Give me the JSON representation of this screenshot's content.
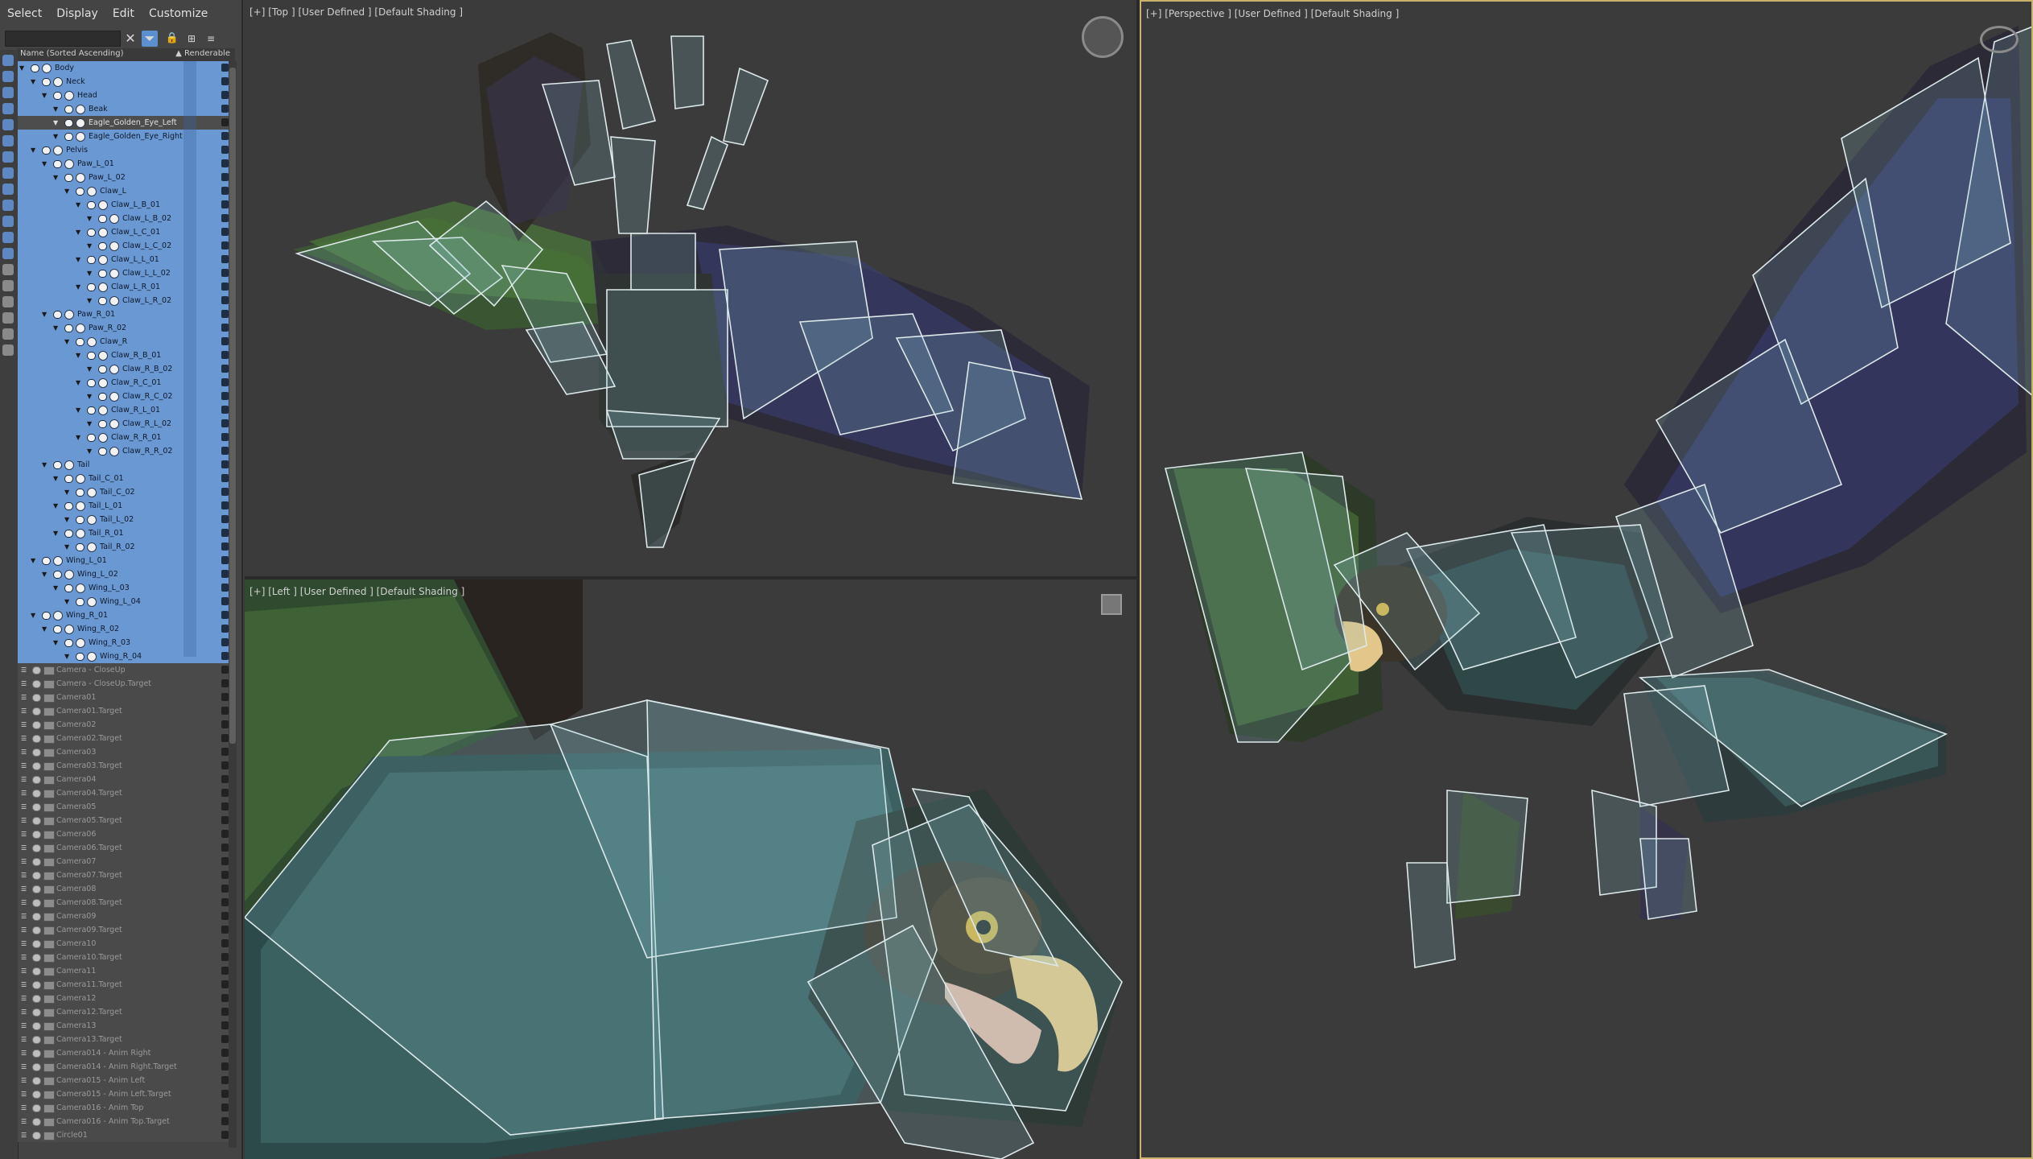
{
  "menubar": [
    "Select",
    "Display",
    "Edit",
    "Customize"
  ],
  "explorer": {
    "column_name": "Name (Sorted Ascending)",
    "column_renderable": "▲ Renderable",
    "tree": [
      {
        "label": "Body",
        "depth": 0,
        "state": "sel"
      },
      {
        "label": "Neck",
        "depth": 1,
        "state": "sel"
      },
      {
        "label": "Head",
        "depth": 2,
        "state": "sel"
      },
      {
        "label": "Beak",
        "depth": 3,
        "state": "sel"
      },
      {
        "label": "Eagle_Golden_Eye_Left",
        "depth": 3,
        "state": "sel-alt"
      },
      {
        "label": "Eagle_Golden_Eye_Right",
        "depth": 3,
        "state": "sel"
      },
      {
        "label": "Pelvis",
        "depth": 1,
        "state": "sel"
      },
      {
        "label": "Paw_L_01",
        "depth": 2,
        "state": "sel"
      },
      {
        "label": "Paw_L_02",
        "depth": 3,
        "state": "sel"
      },
      {
        "label": "Claw_L",
        "depth": 4,
        "state": "sel"
      },
      {
        "label": "Claw_L_B_01",
        "depth": 5,
        "state": "sel"
      },
      {
        "label": "Claw_L_B_02",
        "depth": 6,
        "state": "sel"
      },
      {
        "label": "Claw_L_C_01",
        "depth": 5,
        "state": "sel"
      },
      {
        "label": "Claw_L_C_02",
        "depth": 6,
        "state": "sel"
      },
      {
        "label": "Claw_L_L_01",
        "depth": 5,
        "state": "sel"
      },
      {
        "label": "Claw_L_L_02",
        "depth": 6,
        "state": "sel"
      },
      {
        "label": "Claw_L_R_01",
        "depth": 5,
        "state": "sel"
      },
      {
        "label": "Claw_L_R_02",
        "depth": 6,
        "state": "sel"
      },
      {
        "label": "Paw_R_01",
        "depth": 2,
        "state": "sel"
      },
      {
        "label": "Paw_R_02",
        "depth": 3,
        "state": "sel"
      },
      {
        "label": "Claw_R",
        "depth": 4,
        "state": "sel"
      },
      {
        "label": "Claw_R_B_01",
        "depth": 5,
        "state": "sel"
      },
      {
        "label": "Claw_R_B_02",
        "depth": 6,
        "state": "sel"
      },
      {
        "label": "Claw_R_C_01",
        "depth": 5,
        "state": "sel"
      },
      {
        "label": "Claw_R_C_02",
        "depth": 6,
        "state": "sel"
      },
      {
        "label": "Claw_R_L_01",
        "depth": 5,
        "state": "sel"
      },
      {
        "label": "Claw_R_L_02",
        "depth": 6,
        "state": "sel"
      },
      {
        "label": "Claw_R_R_01",
        "depth": 5,
        "state": "sel"
      },
      {
        "label": "Claw_R_R_02",
        "depth": 6,
        "state": "sel"
      },
      {
        "label": "Tail",
        "depth": 2,
        "state": "sel"
      },
      {
        "label": "Tail_C_01",
        "depth": 3,
        "state": "sel"
      },
      {
        "label": "Tail_C_02",
        "depth": 4,
        "state": "sel"
      },
      {
        "label": "Tail_L_01",
        "depth": 3,
        "state": "sel"
      },
      {
        "label": "Tail_L_02",
        "depth": 4,
        "state": "sel"
      },
      {
        "label": "Tail_R_01",
        "depth": 3,
        "state": "sel"
      },
      {
        "label": "Tail_R_02",
        "depth": 4,
        "state": "sel"
      },
      {
        "label": "Wing_L_01",
        "depth": 1,
        "state": "sel"
      },
      {
        "label": "Wing_L_02",
        "depth": 2,
        "state": "sel"
      },
      {
        "label": "Wing_L_03",
        "depth": 3,
        "state": "sel"
      },
      {
        "label": "Wing_L_04",
        "depth": 4,
        "state": "sel"
      },
      {
        "label": "Wing_R_01",
        "depth": 1,
        "state": "sel"
      },
      {
        "label": "Wing_R_02",
        "depth": 2,
        "state": "sel"
      },
      {
        "label": "Wing_R_03",
        "depth": 3,
        "state": "sel"
      },
      {
        "label": "Wing_R_04",
        "depth": 4,
        "state": "sel"
      },
      {
        "label": "Camera - CloseUp",
        "depth": 0,
        "state": "cam"
      },
      {
        "label": "Camera - CloseUp.Target",
        "depth": 0,
        "state": "cam"
      },
      {
        "label": "Camera01",
        "depth": 0,
        "state": "cam"
      },
      {
        "label": "Camera01.Target",
        "depth": 0,
        "state": "cam"
      },
      {
        "label": "Camera02",
        "depth": 0,
        "state": "cam"
      },
      {
        "label": "Camera02.Target",
        "depth": 0,
        "state": "cam"
      },
      {
        "label": "Camera03",
        "depth": 0,
        "state": "cam"
      },
      {
        "label": "Camera03.Target",
        "depth": 0,
        "state": "cam"
      },
      {
        "label": "Camera04",
        "depth": 0,
        "state": "cam"
      },
      {
        "label": "Camera04.Target",
        "depth": 0,
        "state": "cam"
      },
      {
        "label": "Camera05",
        "depth": 0,
        "state": "cam"
      },
      {
        "label": "Camera05.Target",
        "depth": 0,
        "state": "cam"
      },
      {
        "label": "Camera06",
        "depth": 0,
        "state": "cam"
      },
      {
        "label": "Camera06.Target",
        "depth": 0,
        "state": "cam"
      },
      {
        "label": "Camera07",
        "depth": 0,
        "state": "cam"
      },
      {
        "label": "Camera07.Target",
        "depth": 0,
        "state": "cam"
      },
      {
        "label": "Camera08",
        "depth": 0,
        "state": "cam"
      },
      {
        "label": "Camera08.Target",
        "depth": 0,
        "state": "cam"
      },
      {
        "label": "Camera09",
        "depth": 0,
        "state": "cam"
      },
      {
        "label": "Camera09.Target",
        "depth": 0,
        "state": "cam"
      },
      {
        "label": "Camera10",
        "depth": 0,
        "state": "cam"
      },
      {
        "label": "Camera10.Target",
        "depth": 0,
        "state": "cam"
      },
      {
        "label": "Camera11",
        "depth": 0,
        "state": "cam"
      },
      {
        "label": "Camera11.Target",
        "depth": 0,
        "state": "cam"
      },
      {
        "label": "Camera12",
        "depth": 0,
        "state": "cam"
      },
      {
        "label": "Camera12.Target",
        "depth": 0,
        "state": "cam"
      },
      {
        "label": "Camera13",
        "depth": 0,
        "state": "cam"
      },
      {
        "label": "Camera13.Target",
        "depth": 0,
        "state": "cam"
      },
      {
        "label": "Camera014 - Anim Right",
        "depth": 0,
        "state": "cam"
      },
      {
        "label": "Camera014 - Anim Right.Target",
        "depth": 0,
        "state": "cam"
      },
      {
        "label": "Camera015 - Anim Left",
        "depth": 0,
        "state": "cam"
      },
      {
        "label": "Camera015 - Anim Left.Target",
        "depth": 0,
        "state": "cam"
      },
      {
        "label": "Camera016 - Anim Top",
        "depth": 0,
        "state": "cam"
      },
      {
        "label": "Camera016 - Anim Top.Target",
        "depth": 0,
        "state": "cam"
      },
      {
        "label": "Circle01",
        "depth": 0,
        "state": "cam"
      }
    ]
  },
  "viewports": {
    "top_label": "[+] [Top ] [User Defined ] [Default Shading ]",
    "left_label": "[+] [Left ] [User Defined ] [Default Shading ]",
    "persp_label": "[+] [Perspective ] [User Defined ] [Default Shading ]"
  },
  "icons": {
    "clear": "close-icon",
    "filter": "filter-icon",
    "lock": "lock-icon",
    "hierarchy": "hierarchy-icon",
    "viewcube": "viewcube-icon",
    "orbit": "orbit-icon"
  },
  "colors": {
    "selection": "#6a98d3",
    "active_viewport": "#c9b26a",
    "bone_outline": "#e6f0f0"
  }
}
